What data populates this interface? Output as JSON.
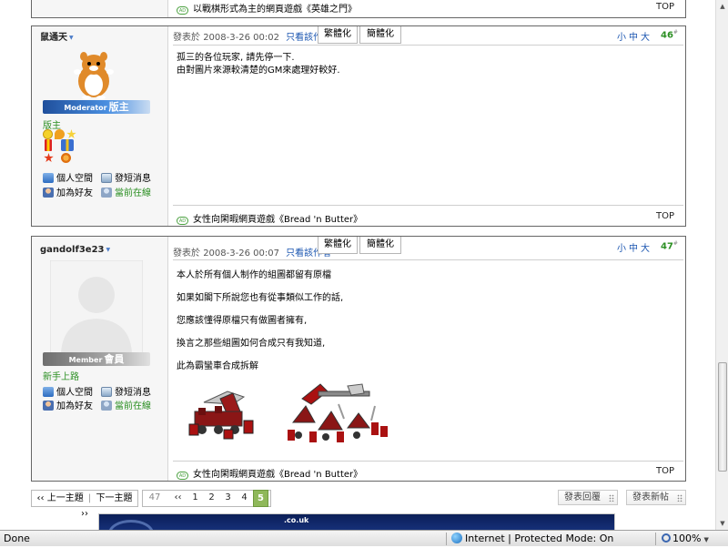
{
  "prev_post": {
    "signature": "以戰棋形式為主的網頁遊戲《英雄之門》",
    "top_label": "TOP"
  },
  "posts": [
    {
      "author": "鼠通天",
      "rank_en": "Moderator",
      "rank_cn": "版主",
      "title": "版主",
      "actions": {
        "space": "個人空間",
        "message": "發短消息",
        "add_friend": "加為好友",
        "online": "當前在線"
      },
      "posted_label": "發表於",
      "timestamp": "2008-3-26 00:02",
      "author_only": "只看該作者",
      "tab_traditional": "繁體化",
      "tab_simplified": "簡體化",
      "font_sizes": "小中大",
      "floor": "46",
      "floor_mark": "#",
      "lines": [
        "孤三的各位玩家, 請先停一下.",
        "由對圖片來源較清楚的GM來處理好較好."
      ],
      "signature": "女性向閑暇網頁遊戲《Bread 'n Butter》",
      "top_label": "TOP"
    },
    {
      "author": "gandolf3e23",
      "rank_en": "Member",
      "rank_cn": "會員",
      "title": "新手上路",
      "actions": {
        "space": "個人空間",
        "message": "發短消息",
        "add_friend": "加為好友",
        "online": "當前在線"
      },
      "posted_label": "發表於",
      "timestamp": "2008-3-26 00:07",
      "author_only": "只看該作者",
      "tab_traditional": "繁體化",
      "tab_simplified": "簡體化",
      "font_sizes": "小中大",
      "floor": "47",
      "floor_mark": "#",
      "lines": [
        "本人於所有個人制作的組圖都留有原檔",
        "如果如閣下所說您也有從事類似工作的話,",
        "您應該懂得原檔只有做圖者擁有,",
        "換言之那些組圖如何合成只有我知道,",
        "此為霸蠻車合成拆解"
      ],
      "signature": "女性向閑暇網頁遊戲《Bread 'n Butter》",
      "top_label": "TOP"
    }
  ],
  "nav": {
    "prev_thread": "‹‹ 上一主題",
    "next_thread": "下一主題 ››",
    "total_pages": "47",
    "first_arrow": "‹‹",
    "pages": [
      "1",
      "2",
      "3",
      "4",
      "5"
    ],
    "current_page": "5"
  },
  "buttons": {
    "reply": "發表回覆",
    "new_topic": "發表新帖"
  },
  "banner": {
    "domain": ".co.uk"
  },
  "statusbar": {
    "status": "Done",
    "zone": "Internet | Protected Mode: On",
    "zoom": "100%"
  },
  "colors": {
    "green_text": "#2b8f22",
    "link_blue": "#1a55b0",
    "moderator_bar": "#1f4f9c",
    "member_bar": "#6e6e6e",
    "current_page": "#8fb85a"
  }
}
